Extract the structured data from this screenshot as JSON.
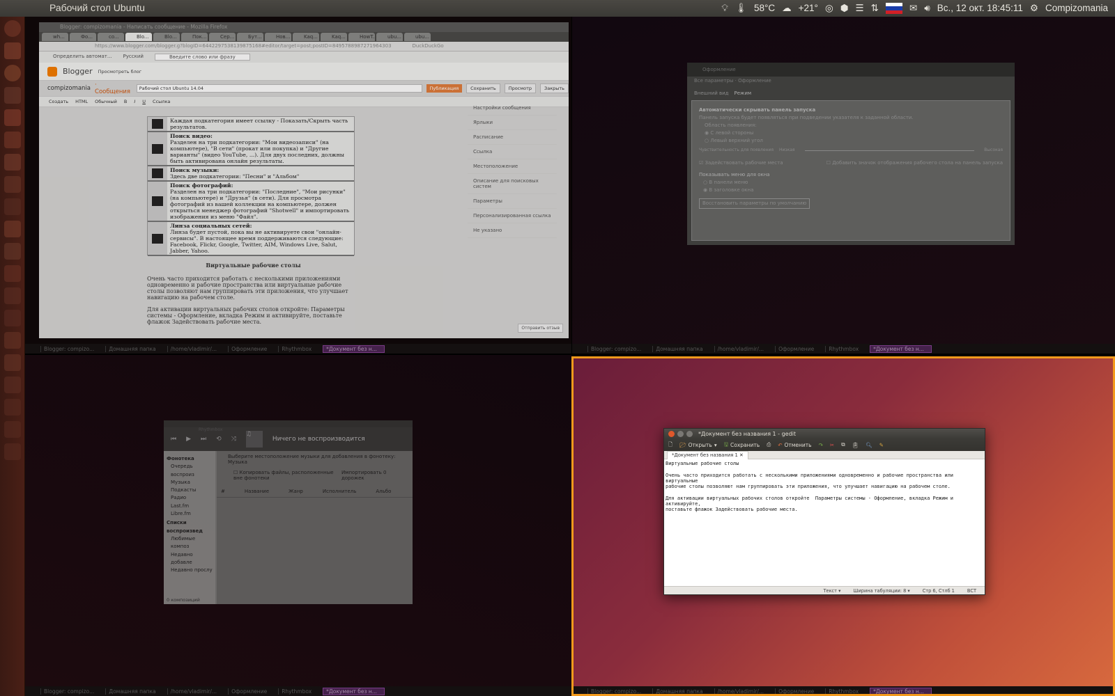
{
  "topbar": {
    "title": "Рабочий стол Ubuntu",
    "temperature": "58°C",
    "weather": "+21°",
    "datetime": "Вс., 12 окт. 18:45:11",
    "session_name": "Compizomania"
  },
  "taskbar": {
    "items": [
      "Blogger: compizo...",
      "Домашняя папка",
      "/home/vladimir/...",
      "Оформление",
      "Rhythmbox",
      "*Документ без н..."
    ]
  },
  "firefox": {
    "title": "Blogger: compizomania - Написать сообщение - Mozilla Firefox",
    "tabs": [
      "wh...",
      "Фо...",
      "co...",
      "Blo...",
      "Blo...",
      "Пок...",
      "Сер...",
      "Бут...",
      "Нов...",
      "Kaq...",
      "Kaq...",
      "HowT...",
      "ubu...",
      "ubu..."
    ],
    "url": "https://www.blogger.com/blogger.g?blogID=6442297538139875168#editor/target=post;postID=8495788987271964303",
    "search": "DuckDuckGo",
    "translate_from": "Определить автомат...",
    "translate_to": "Русский",
    "translate_placeholder": "Введите слово или фразу",
    "blogger_logo": "Blogger",
    "blog_view": "Просмотреть блог",
    "blog_name": "compizomania",
    "blog_section": "· Сообщения",
    "post_title": "Рабочий стол Ubuntu 14.04",
    "btn_publish": "Публикация",
    "btn_save": "Сохранить",
    "btn_preview": "Просмотр",
    "btn_close": "Закрыть",
    "btn_compose": "Создать",
    "btn_html": "HTML",
    "font_name": "Обычный",
    "link_label": "Ссылка",
    "feedback": "Отправить отзыв",
    "doc_rows": [
      {
        "title": "",
        "text": "Каждая подкатегория имеет ссылку - Показать/Скрыть часть результатов."
      },
      {
        "title": "Поиск видео:",
        "text": "Разделен на три подкатегории: \"Мои видеозаписи\" (на компьютере), \"В сети\" (прокат или покупка) и \"Другие варианты\" (видео YouTube, ...). Для двух последних, должны быть активирована онлайн результаты."
      },
      {
        "title": "Поиск музыки:",
        "text": "Здесь две подкатегории: \"Песни\" и \"Альбом\""
      },
      {
        "title": "Поиск фотографий:",
        "text": "Разделен на три подкатегории: \"Последние\", \"Мои рисунки\" (на компьютере) и \"Друзья\" (в сети). Для просмотра фотографий из вашей коллекции на компьютере, должен открыться менеджер фотографий \"Shotwell\" и импортировать изображения из меню \"Файл\"."
      },
      {
        "title": "Линза социальных сетей:",
        "text": "Линза будет пустой, пока вы не активируете свои \"онлайн-сервисы\". В настоящее время поддерживаются следующие: Facebook, Flickr, Google, Twitter, AIM, Windows Live, Salut, Jabber, Yahoo."
      }
    ],
    "article_heading": "Виртуальные рабочие столы",
    "article_p1": "Очень часто приходится работать с несколькими приложениями одновременно и рабочие пространства или виртуальные рабочие столы позволяют нам группировать эти приложения, что улучшает навигацию на рабочем столе.",
    "article_p2": "Для активации виртуальных рабочих столов откройте: Параметры системы - Оформление, вкладка Режим и активируйте, поставьте флажок Задействовать рабочие места.",
    "sidepanel": [
      "Настройки сообщения",
      "Ярлыки",
      "Расписание",
      "Ссылка",
      "Местоположение",
      "Описание для поисковых систем",
      "Параметры",
      "Персонализированная ссылка",
      "Не указано"
    ]
  },
  "appearance": {
    "title": "Оформление",
    "breadcrumb": "Все параметры · Оформление",
    "tab_look": "Внешний вид",
    "tab_mode": "Режим",
    "autohide_title": "Автоматически скрывать панель запуска",
    "autohide_desc": "Панель запуска будет появляться при подведении указателя к заданной области.",
    "reveal_location": "Область появления:",
    "left_side": "С левой стороны",
    "top_left": "Левый верхний угол",
    "sensitivity": "Чувствительность для появления",
    "low": "Низкая",
    "high": "Высокая",
    "enable_workspaces": "Задействовать рабочие места",
    "show_desktop_icon": "Добавить значок отображения рабочего стола на панель запуска",
    "menus_label": "Показывать меню для окна",
    "in_menu_bar": "В панели меню",
    "in_title_bar": "В заголовке окна",
    "restore_btn": "Восстановить параметры по умолчанию"
  },
  "rhythmbox": {
    "title": "Rhythmbox",
    "now_playing": "Ничего не воспроизводится",
    "library_label": "Фонотека",
    "library_items": [
      "Очередь воспроиз",
      "Музыка",
      "Подкасты",
      "Радио",
      "Last.fm",
      "Libre.fm"
    ],
    "playlists_label": "Списки воспроизвед",
    "playlist_items": [
      "Любимые композ",
      "Недавно добавле",
      "Недавно прослу"
    ],
    "import_prompt": "Выберите местоположение музыки для добавления в фонотеку:",
    "import_location": "Музыка",
    "copy_files": "Копировать файлы, расположенные вне фонотеки",
    "import_btn": "Импортировать 0 дорожек",
    "columns": [
      "#",
      "Название",
      "Жанр",
      "Исполнитель",
      "Альбо"
    ],
    "status": "0 композиций"
  },
  "gedit": {
    "title": "*Документ без названия 1 - gedit",
    "btn_open": "Открыть",
    "btn_save": "Сохранить",
    "btn_undo": "Отменить",
    "tab_label": "*Документ без названия 1",
    "text": "Виртуальные рабочие столы\n\nОчень часто приходится работать с несколькими приложениями одновременно и рабочие пространства или виртуальные\nрабочие столы позволяют нам группировать эти приложения, что улучшает навигацию на рабочем столе.\n\nДля активации виртуальных рабочих столов откройте  Параметры системы - Оформление, вкладка Режим и активируйте,\nпоставьте флажок Задействовать рабочие места.",
    "status_mode": "Текст ▾",
    "status_tab": "Ширина табуляции: 8 ▾",
    "status_pos": "Стр 6, Стлб 1",
    "status_ins": "ВСТ"
  },
  "colors": {
    "launcher": "#4a1f16",
    "topbar": "#3c3b37",
    "active_frame": "#f39a1c",
    "gedit_close": "#e0582b"
  }
}
